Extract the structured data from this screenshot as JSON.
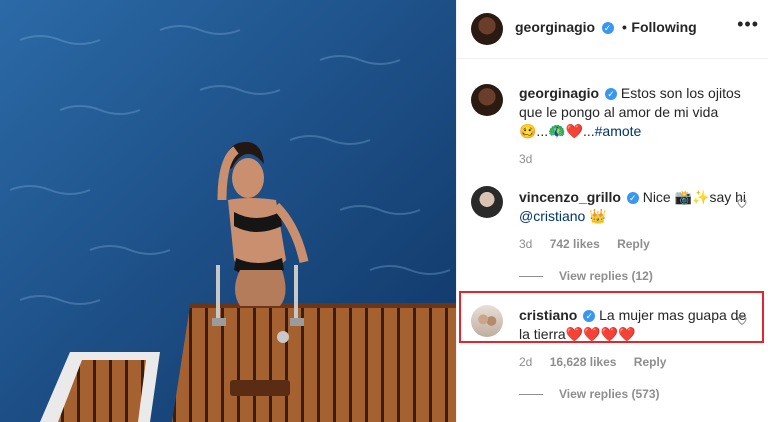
{
  "header": {
    "username": "georginagio",
    "separator": "•",
    "following": "Following",
    "more": "•••"
  },
  "caption": {
    "username": "georginagio",
    "text": "Estos son los ojitos que le pongo al amor de mi vida 🥴...🦚❤️...",
    "hashtag": "#amote",
    "time": "3d"
  },
  "comments": [
    {
      "username": "vincenzo_grillo",
      "text_pre": "Nice 📸✨say hi ",
      "mention": "@cristiano",
      "text_post": " 👑",
      "time": "3d",
      "likes": "742 likes",
      "reply": "Reply",
      "view_replies": "View replies (12)"
    },
    {
      "username": "cristiano",
      "text": "La mujer mas guapa de la tierra",
      "hearts": "❤️❤️❤️❤️",
      "time": "2d",
      "likes": "16,628 likes",
      "reply": "Reply",
      "view_replies": "View replies (573)"
    }
  ],
  "colors": {
    "water": "#1d4f86",
    "deck": "#8a4a26",
    "highlight_box": "#e3262b",
    "verified": "#3897f0"
  }
}
